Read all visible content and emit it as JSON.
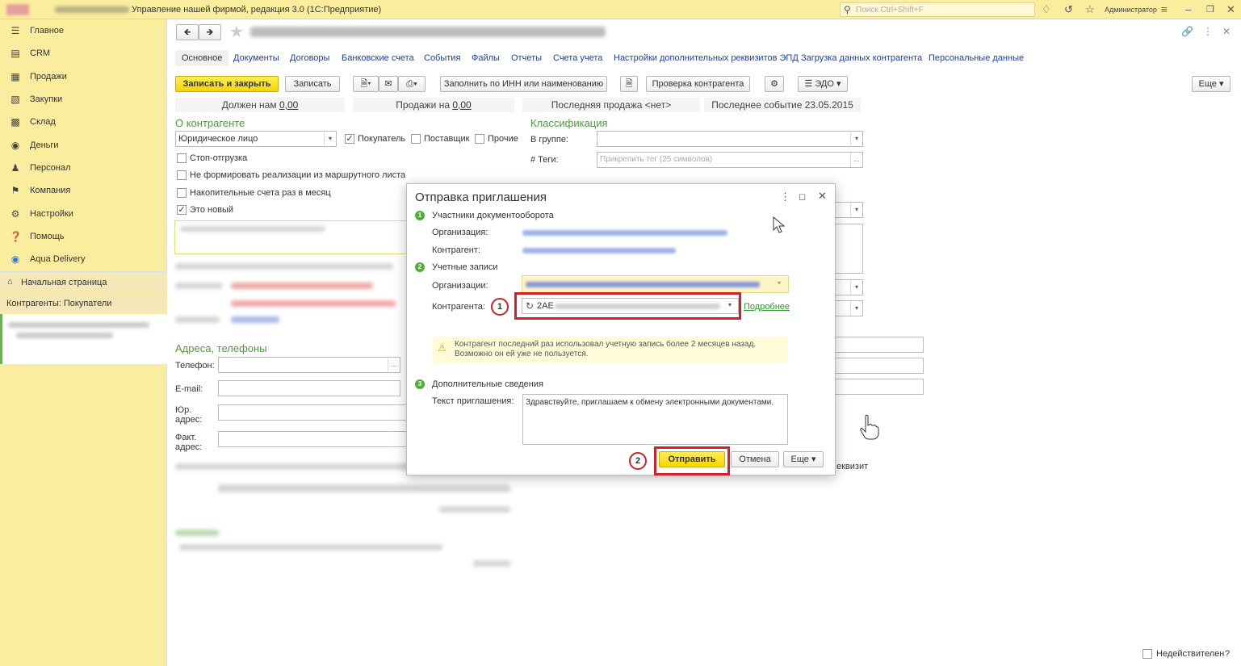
{
  "app": {
    "title": "Управление нашей фирмой, редакция 3.0  (1С:Предприятие)",
    "search_placeholder": "Поиск Ctrl+Shift+F",
    "user": "Администратор"
  },
  "sidebar": {
    "items": [
      {
        "label": "Главное",
        "icon": "menu-icon"
      },
      {
        "label": "CRM",
        "icon": "crm-icon"
      },
      {
        "label": "Продажи",
        "icon": "cart-icon"
      },
      {
        "label": "Закупки",
        "icon": "purchase-icon"
      },
      {
        "label": "Склад",
        "icon": "warehouse-icon"
      },
      {
        "label": "Деньги",
        "icon": "money-icon"
      },
      {
        "label": "Персонал",
        "icon": "people-icon"
      },
      {
        "label": "Компания",
        "icon": "flag-icon"
      },
      {
        "label": "Настройки",
        "icon": "gear-icon"
      },
      {
        "label": "Помощь",
        "icon": "help-icon"
      },
      {
        "label": "Aqua Delivery",
        "icon": "drop-icon"
      }
    ],
    "home": "Начальная страница",
    "open_tab": "Контрагенты: Покупатели"
  },
  "form": {
    "tabs": [
      "Основное",
      "Документы",
      "Договоры",
      "Банковские счета",
      "События",
      "Файлы",
      "Отчеты",
      "Счета учета",
      "Настройки дополнительных реквизитов ЭПД",
      "Загрузка данных контрагента",
      "Персональные данные"
    ],
    "toolbar": {
      "save_close": "Записать и закрыть",
      "save": "Записать",
      "fill_inn": "Заполнить по ИНН или наименованию",
      "check": "Проверка контрагента",
      "edo": "ЭДО",
      "more": "Еще"
    },
    "stats": {
      "owes_label": "Должен нам",
      "owes_value": "0,00",
      "sales_label": "Продажи на",
      "sales_value": "0,00",
      "last_sale": "Последняя продажа <нет>",
      "last_event": "Последнее событие 23.05.2015"
    },
    "about": {
      "header": "О контрагенте",
      "type_value": "Юридическое лицо",
      "buyer": "Покупатель",
      "supplier": "Поставщик",
      "other": "Прочие",
      "stop": "Стоп-отгрузка",
      "no_route": "Не формировать реализации из маршрутного листа",
      "cumulative": "Накопительные счета раз в месяц",
      "is_new": "Это новый"
    },
    "classification": {
      "header": "Классификация",
      "group_label": "В группе:",
      "tags_label": "# Теги:",
      "tags_placeholder": "Прикрепить тег (25 символов)"
    },
    "contacts": {
      "header": "Адреса, телефоны",
      "phone": "Телефон:",
      "email": "E-mail:",
      "legal1": "Юр.",
      "legal2": "адрес:",
      "fact1": "Факт.",
      "fact2": "адрес:"
    },
    "partial_text": "еквизит",
    "inactive": "Недействителен",
    "help_q": "?"
  },
  "dialog": {
    "title": "Отправка приглашения",
    "step1": "Участники документооборота",
    "org_label": "Организация:",
    "contractor_label": "Контрагент:",
    "step2": "Учетные записи",
    "orgs_label": "Организации:",
    "contractors_label": "Контрагента:",
    "account_value": "2АЕ",
    "details_link": "Подробнее",
    "warn_line1": "Контрагент последний раз использовал  учетную запись  более 2 месяцев назад.",
    "warn_line2": "Возможно он ей уже не пользуется.",
    "step3": "Дополнительные сведения",
    "invite_label": "Текст приглашения:",
    "invite_text": "Здравствуйте, приглашаем к обмену электронными документами.",
    "send": "Отправить",
    "cancel": "Отмена",
    "more": "Еще"
  },
  "annotations": {
    "marker1": "1",
    "marker2": "2"
  },
  "colors": {
    "accent_yellow": "#fbed9e",
    "button_yellow": "#f5d700",
    "header_green": "#4c9a3a",
    "link_blue": "#1a3ea6",
    "annotation_red": "#d1222a"
  }
}
